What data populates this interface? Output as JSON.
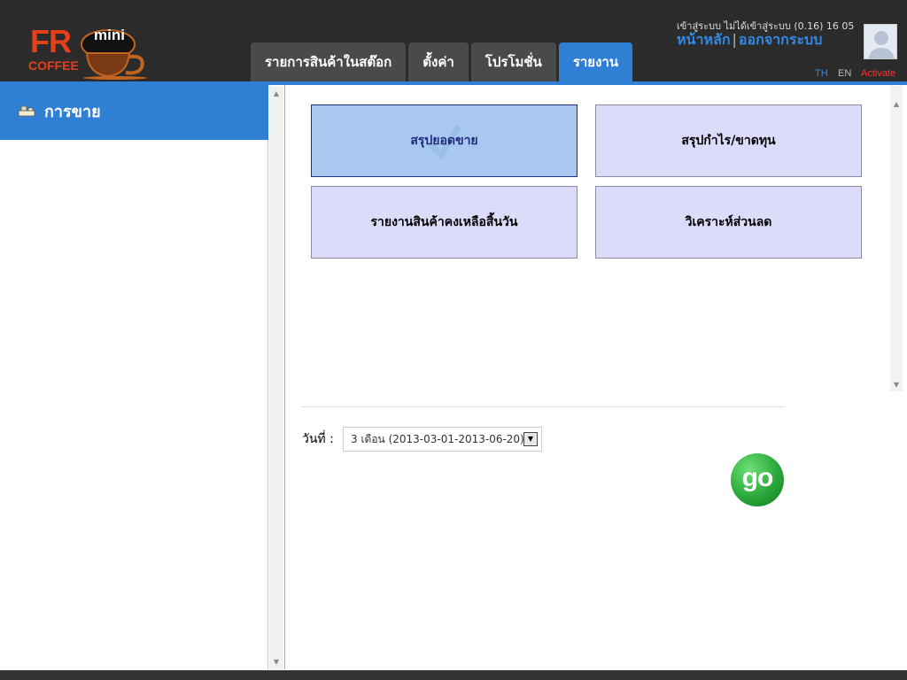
{
  "app": {
    "logo_main": "FR",
    "logo_mini": "mini",
    "logo_sub": "COFFEE"
  },
  "tabs": [
    {
      "label": "รายการสินค้าในสต๊อก",
      "active": false
    },
    {
      "label": "ตั้งค่า",
      "active": false
    },
    {
      "label": "โปรโมชั่น",
      "active": false
    },
    {
      "label": "รายงาน",
      "active": true
    }
  ],
  "header": {
    "status": "เข้าสู่ระบบ ไม่ได้เข้าสู่ระบบ (0.16) 16 05",
    "home_link": "หน้าหลัก",
    "separator": "|",
    "logout_link": "ออกจากระบบ",
    "lang_th": "TH",
    "lang_en": "EN",
    "activate": "Activate"
  },
  "sidebar": {
    "items": [
      {
        "label": "การขาย",
        "icon": "sales-icon"
      }
    ]
  },
  "reports": {
    "buttons": [
      {
        "label": "สรุปยอดขาย",
        "selected": true
      },
      {
        "label": "สรุปกำไร/ขาดทุน",
        "selected": false
      },
      {
        "label": "รายงานสินค้าคงเหลือสิ้นวัน",
        "selected": false
      },
      {
        "label": "วิเคราะห์ส่วนลด",
        "selected": false
      }
    ]
  },
  "filter": {
    "date_label": "วันที่ :",
    "date_value": "3 เดือน (2013-03-01-2013-06-20)",
    "go_label": "go"
  },
  "colors": {
    "accent": "#2f7fd4",
    "topbar": "#2b2b2b",
    "brand": "#e4411b",
    "activate": "#ff3030",
    "lang_th": "#2f8be8",
    "lang_en": "#bbbbbb"
  }
}
